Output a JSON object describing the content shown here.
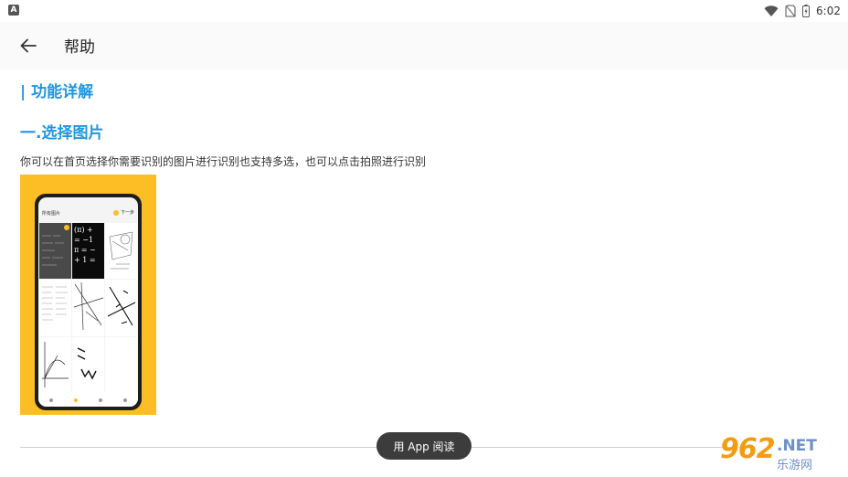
{
  "status_bar": {
    "app_icon_letter": "A",
    "time": "6:02"
  },
  "app_bar": {
    "title": "帮助"
  },
  "content": {
    "section_title": "| 功能详解",
    "subsection_title": "一.选择图片",
    "paragraph": "你可以在首页选择你需要识别的图片进行识别也支持多选，也可以点击拍照进行识别"
  },
  "illustration": {
    "header": "所有图片",
    "next": "下一步",
    "math_lines": [
      "(π) +",
      "= −1",
      "π = −",
      "+ 1 ="
    ],
    "accent_color": "#fdbe25"
  },
  "bottom": {
    "open_in_app": "用 App 阅读"
  },
  "watermark": {
    "logo": "962",
    "net": ".NET",
    "sub": "乐游网"
  },
  "icons": {
    "back": "arrow-left-icon",
    "wifi": "wifi-icon",
    "signal": "no-sim-icon",
    "battery": "battery-icon"
  },
  "colors": {
    "heading": "#2196e0",
    "pill_bg": "#3c3c3c"
  }
}
